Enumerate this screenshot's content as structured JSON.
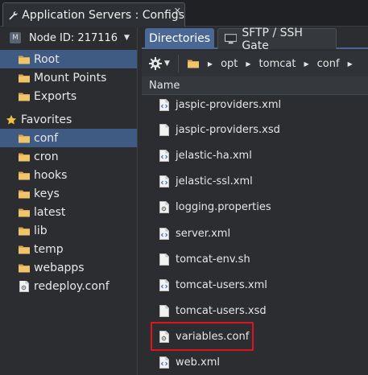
{
  "window": {
    "tab_title": "Application Servers : Configs",
    "close_glyph": "✕"
  },
  "sidebar": {
    "node_badge": "M",
    "node_label": "Node ID: 217116",
    "items": [
      {
        "label": "Root",
        "icon": "folder-icon",
        "selected": true
      },
      {
        "label": "Mount Points",
        "icon": "folder-icon"
      },
      {
        "label": "Exports",
        "icon": "folder-icon"
      }
    ],
    "favorites_label": "Favorites",
    "favorites": [
      {
        "label": "conf",
        "icon": "folder-icon",
        "selected": true
      },
      {
        "label": "cron",
        "icon": "folder-icon"
      },
      {
        "label": "hooks",
        "icon": "folder-icon"
      },
      {
        "label": "keys",
        "icon": "folder-icon"
      },
      {
        "label": "latest",
        "icon": "folder-icon"
      },
      {
        "label": "lib",
        "icon": "folder-icon"
      },
      {
        "label": "temp",
        "icon": "folder-icon"
      },
      {
        "label": "webapps",
        "icon": "folder-icon"
      },
      {
        "label": "redeploy.conf",
        "icon": "file-icon"
      }
    ]
  },
  "tabs": [
    {
      "label": "Directories",
      "active": true
    },
    {
      "label": "SFTP / SSH Gate",
      "active": false
    }
  ],
  "breadcrumb": [
    "opt",
    "tomcat",
    "conf"
  ],
  "table": {
    "column_name": "Name"
  },
  "files": [
    {
      "name": "jaspic-providers.xml",
      "type": "code"
    },
    {
      "name": "jaspic-providers.xsd",
      "type": "plain"
    },
    {
      "name": "jelastic-ha.xml",
      "type": "code"
    },
    {
      "name": "jelastic-ssl.xml",
      "type": "code"
    },
    {
      "name": "logging.properties",
      "type": "gear"
    },
    {
      "name": "server.xml",
      "type": "code"
    },
    {
      "name": "tomcat-env.sh",
      "type": "plain"
    },
    {
      "name": "tomcat-users.xml",
      "type": "code"
    },
    {
      "name": "tomcat-users.xsd",
      "type": "plain"
    },
    {
      "name": "variables.conf",
      "type": "gear",
      "highlighted": true
    },
    {
      "name": "web.xml",
      "type": "code"
    }
  ],
  "colors": {
    "selected": "#3f5a83",
    "active_tab": "#4a6896",
    "highlight_border": "#e0141c",
    "folder": "#e6b75a"
  }
}
